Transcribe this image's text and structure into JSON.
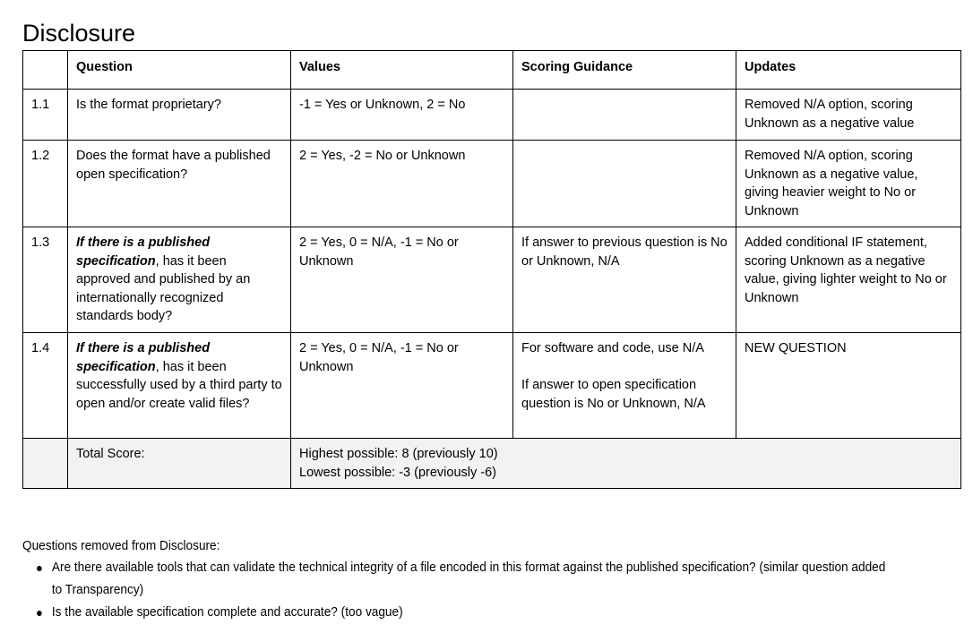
{
  "page_title": "Disclosure",
  "table": {
    "headers": [
      "",
      "Question",
      "Values",
      "Scoring Guidance",
      "Updates"
    ],
    "rows": [
      {
        "num": "1.1",
        "question_prefix": "",
        "question": "Is the format proprietary?",
        "values": "-1 = Yes or Unknown, 2 = No",
        "scoring_guidance": "",
        "updates": "Removed N/A option, scoring Unknown as a negative value"
      },
      {
        "num": "1.2",
        "question_prefix": "",
        "question": "Does the format have a published open specification?",
        "values": "2 = Yes, -2 = No or Unknown",
        "scoring_guidance": "",
        "updates": "Removed N/A option, scoring Unknown as a negative value, giving heavier weight to No or Unknown"
      },
      {
        "num": "1.3",
        "question_prefix": "If there is a published specification",
        "question": ", has it been approved and published by an internationally recognized standards body?",
        "values": "2 = Yes, 0 = N/A, -1 = No or Unknown",
        "scoring_guidance": "If answer to previous question is No or Unknown, N/A",
        "updates": "Added conditional IF statement, scoring Unknown as a negative value, giving lighter weight to No or Unknown"
      },
      {
        "num": "1.4",
        "question_prefix": "If there is a published specification",
        "question": ", has it been successfully used by a third party to open and/or create valid files?",
        "values": "2 = Yes, 0 = N/A, -1 = No or Unknown",
        "scoring_guidance_line1": "For software and code, use N/A",
        "scoring_guidance_line2": "If answer to open specification question is No or Unknown, N/A",
        "updates": "NEW QUESTION"
      }
    ],
    "total_row": {
      "label": "Total Score:",
      "highest": "Highest possible: 8 (previously 10)",
      "lowest": "Lowest possible: -3 (previously -6)"
    }
  },
  "notes": {
    "lead": "Questions removed from Disclosure:",
    "bullet_glyph": "●",
    "items": [
      "Are there available tools that can validate the technical integrity of a file encoded in this format against the published specification? (similar question added to Transparency)",
      "Is the available specification complete and accurate? (too vague)"
    ]
  },
  "colors": {
    "border": "#000000",
    "total_row_background": "#f2f2f2",
    "text": "#000000"
  }
}
